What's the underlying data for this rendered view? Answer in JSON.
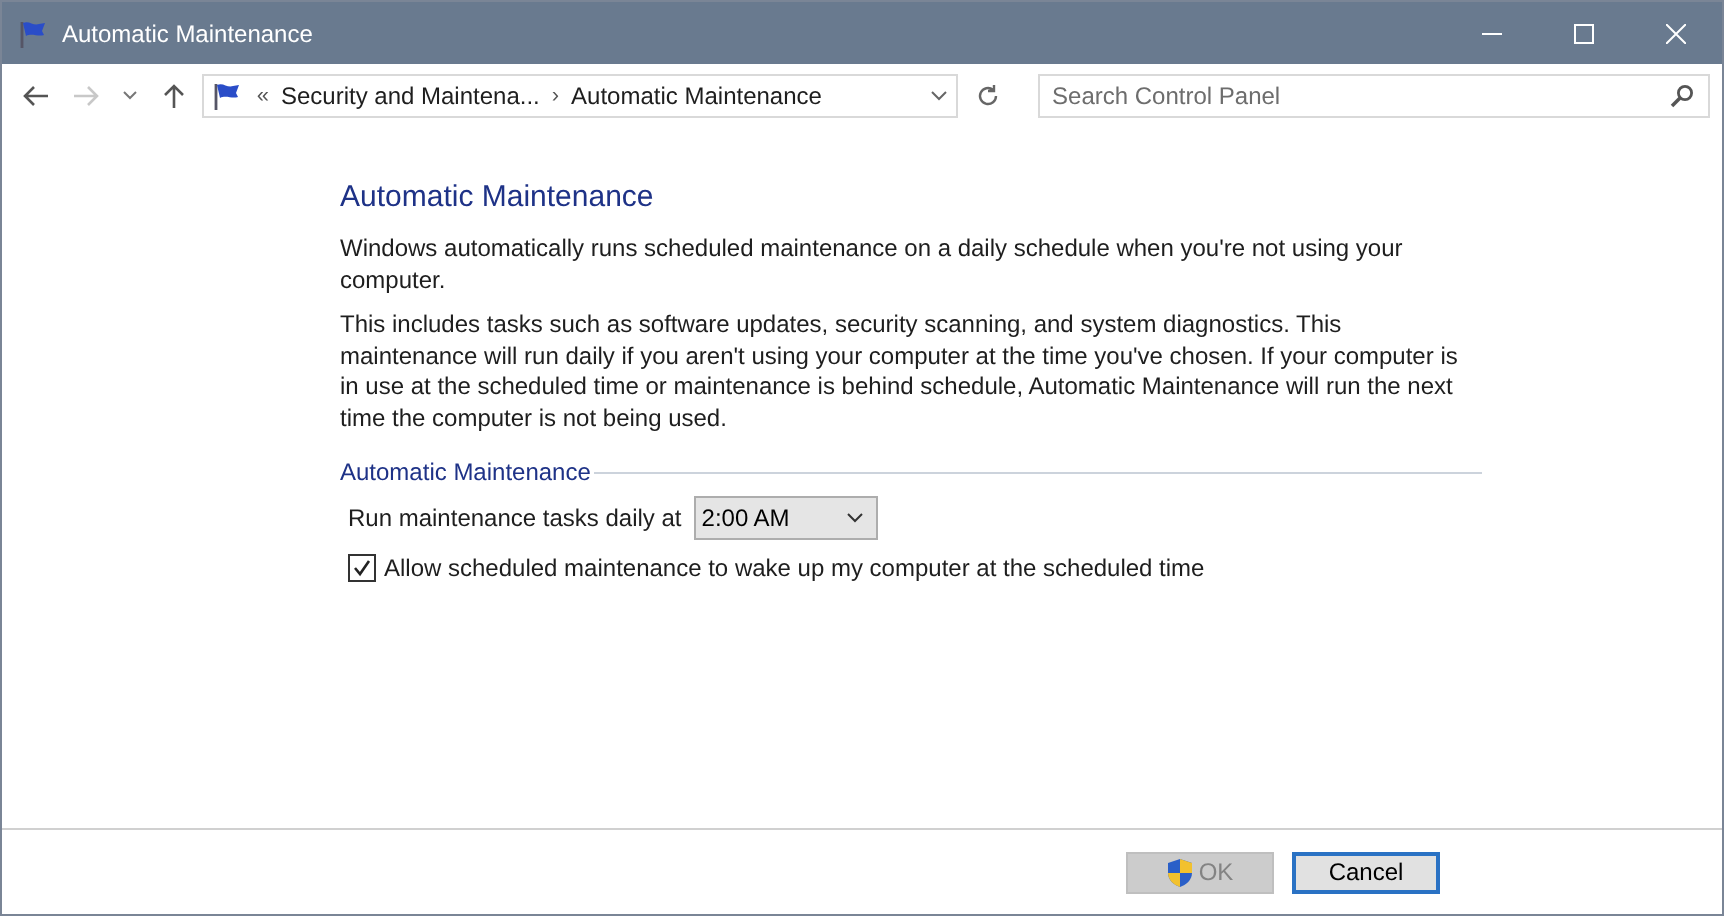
{
  "window": {
    "title": "Automatic Maintenance"
  },
  "nav": {
    "back_disabled": false,
    "forward_disabled": true,
    "breadcrumbs": [
      {
        "prefix": "«",
        "label": "Security and Maintena..."
      },
      {
        "prefix": "›",
        "label": "Automatic Maintenance"
      }
    ],
    "search": {
      "placeholder": "Search Control Panel"
    }
  },
  "content": {
    "heading": "Automatic Maintenance",
    "paragraphs": [
      "Windows automatically runs scheduled maintenance on a daily schedule when you're not using your computer.",
      "This includes tasks such as software updates, security scanning, and system diagnostics. This maintenance will run daily if you aren't using your computer at the time you've chosen. If your computer is in use at the scheduled time or maintenance is behind schedule, Automatic Maintenance will run the next time the computer is not being used."
    ],
    "group": {
      "title": "Automatic Maintenance",
      "time_label": "Run maintenance tasks daily at",
      "time_value": "2:00 AM",
      "wake": {
        "label": "Allow scheduled maintenance to wake up my computer at the scheduled time",
        "checked": true
      }
    }
  },
  "buttons": [
    {
      "label": "OK",
      "disabled": true,
      "default": false,
      "shield": true
    },
    {
      "label": "Cancel",
      "disabled": false,
      "default": true,
      "shield": false
    }
  ]
}
